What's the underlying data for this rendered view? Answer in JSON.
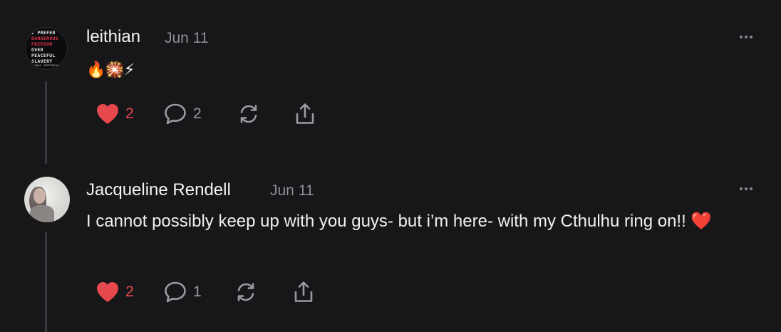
{
  "comments": [
    {
      "username": "leithian",
      "date": "Jun 11",
      "avatar_text": [
        "I PREFER",
        "DANGEROUS",
        "FREEDOM",
        "OVER",
        "PEACEFUL",
        "SLAVERY",
        "THOMAS JEFFERSON"
      ],
      "body": "🔥🎇⚡",
      "likes": "2",
      "replies": "2",
      "liked": true
    },
    {
      "username": "Jacqueline Rendell",
      "date": "Jun 11",
      "body": "I cannot possibly keep up with you guys- but i’m here- with my Cthulhu ring on!! ❤️",
      "likes": "2",
      "replies": "1",
      "liked": true
    }
  ],
  "icons": {
    "like": "heart-icon",
    "reply": "comment-bubble-icon",
    "restack": "restack-icon",
    "share": "share-icon",
    "more": "more-dots-icon"
  },
  "colors": {
    "background": "#17171a",
    "liked": "#e5484d",
    "muted": "#8e8e93",
    "thread_line": "#3a3a3e"
  }
}
